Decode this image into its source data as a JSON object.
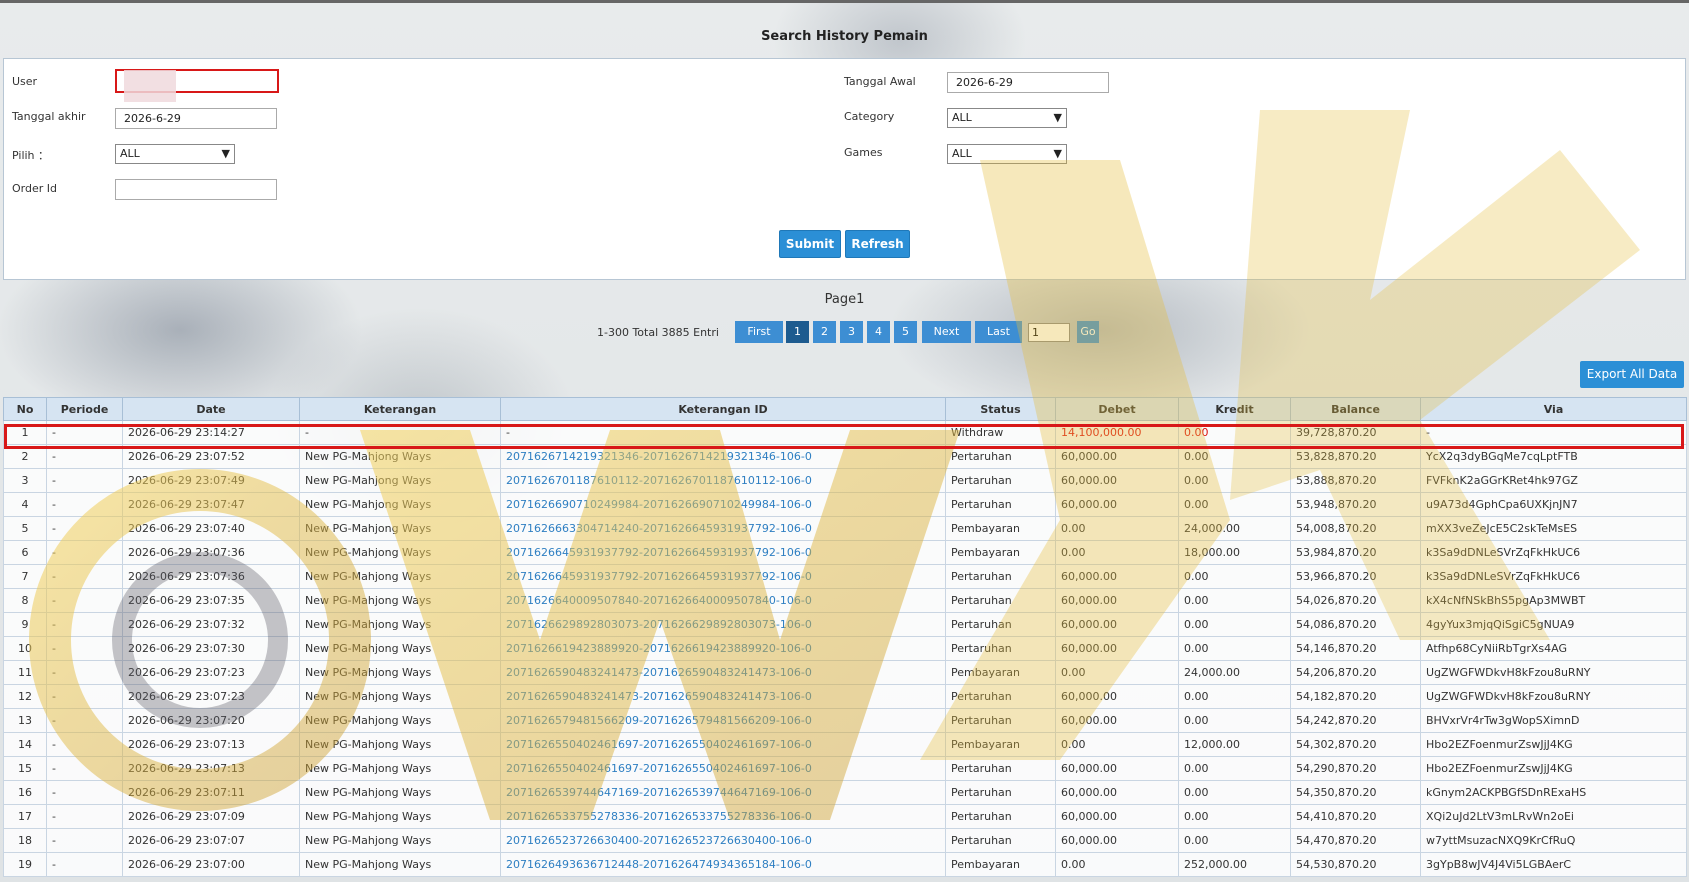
{
  "page": {
    "title": "Search History Pemain",
    "page_label": "Page1"
  },
  "form": {
    "user_label": "User",
    "user_value": "",
    "tanggal_akhir_label": "Tanggal akhir",
    "tanggal_akhir_value": "2026-6-29",
    "pilih_label": "Pilih ：",
    "pilih_value": "ALL",
    "order_id_label": "Order Id",
    "order_id_value": "",
    "tanggal_awal_label": "Tanggal Awal",
    "tanggal_awal_value": "2026-6-29",
    "category_label": "Category",
    "category_value": "ALL",
    "games_label": "Games",
    "games_value": "ALL",
    "submit_label": "Submit",
    "refresh_label": "Refresh"
  },
  "pager": {
    "info": "1-300 Total 3885 Entri",
    "first": "First",
    "pages": [
      "1",
      "2",
      "3",
      "4",
      "5"
    ],
    "active_page": "1",
    "next": "Next",
    "last": "Last",
    "goto_value": "1",
    "go": "Go"
  },
  "export_label": "Export All Data",
  "table": {
    "headers": [
      "No",
      "Periode",
      "Date",
      "Keterangan",
      "Keterangan ID",
      "Status",
      "Debet",
      "Kredit",
      "Balance",
      "Via"
    ],
    "rows": [
      [
        "1",
        "-",
        "2026-06-29 23:14:27",
        "-",
        "-",
        "Withdraw",
        "14,100,000.00",
        "0.00",
        "39,728,870.20",
        "-"
      ],
      [
        "2",
        "-",
        "2026-06-29 23:07:52",
        "New PG-Mahjong Ways",
        "2071626714219321346-2071626714219321346-106-0",
        "Pertaruhan",
        "60,000.00",
        "0.00",
        "53,828,870.20",
        "YcX2q3dyBGqMe7cqLptFTB"
      ],
      [
        "3",
        "-",
        "2026-06-29 23:07:49",
        "New PG-Mahjong Ways",
        "2071626701187610112-2071626701187610112-106-0",
        "Pertaruhan",
        "60,000.00",
        "0.00",
        "53,888,870.20",
        "FVFknK2aGGrKRet4hk97GZ"
      ],
      [
        "4",
        "-",
        "2026-06-29 23:07:47",
        "New PG-Mahjong Ways",
        "2071626690710249984-2071626690710249984-106-0",
        "Pertaruhan",
        "60,000.00",
        "0.00",
        "53,948,870.20",
        "u9A73d4GphCpa6UXKjnJN7"
      ],
      [
        "5",
        "-",
        "2026-06-29 23:07:40",
        "New PG-Mahjong Ways",
        "2071626663304714240-2071626645931937792-106-0",
        "Pembayaran",
        "0.00",
        "24,000.00",
        "54,008,870.20",
        "mXX3veZeJcE5C2skTeMsES"
      ],
      [
        "6",
        "-",
        "2026-06-29 23:07:36",
        "New PG-Mahjong Ways",
        "2071626645931937792-2071626645931937792-106-0",
        "Pembayaran",
        "0.00",
        "18,000.00",
        "53,984,870.20",
        "k3Sa9dDNLeSVrZqFkHkUC6"
      ],
      [
        "7",
        "-",
        "2026-06-29 23:07:36",
        "New PG-Mahjong Ways",
        "2071626645931937792-2071626645931937792-106-0",
        "Pertaruhan",
        "60,000.00",
        "0.00",
        "53,966,870.20",
        "k3Sa9dDNLeSVrZqFkHkUC6"
      ],
      [
        "8",
        "-",
        "2026-06-29 23:07:35",
        "New PG-Mahjong Ways",
        "2071626640009507840-2071626640009507840-106-0",
        "Pertaruhan",
        "60,000.00",
        "0.00",
        "54,026,870.20",
        "kX4cNfNSkBhS5pgAp3MWBT"
      ],
      [
        "9",
        "-",
        "2026-06-29 23:07:32",
        "New PG-Mahjong Ways",
        "2071626629892803073-2071626629892803073-106-0",
        "Pertaruhan",
        "60,000.00",
        "0.00",
        "54,086,870.20",
        "4gyYux3mjqQiSgiC5gNUA9"
      ],
      [
        "10",
        "-",
        "2026-06-29 23:07:30",
        "New PG-Mahjong Ways",
        "2071626619423889920-2071626619423889920-106-0",
        "Pertaruhan",
        "60,000.00",
        "0.00",
        "54,146,870.20",
        "Atfhp68CyNiiRbTgrXs4AG"
      ],
      [
        "11",
        "-",
        "2026-06-29 23:07:23",
        "New PG-Mahjong Ways",
        "2071626590483241473-2071626590483241473-106-0",
        "Pembayaran",
        "0.00",
        "24,000.00",
        "54,206,870.20",
        "UgZWGFWDkvH8kFzou8uRNY"
      ],
      [
        "12",
        "-",
        "2026-06-29 23:07:23",
        "New PG-Mahjong Ways",
        "2071626590483241473-2071626590483241473-106-0",
        "Pertaruhan",
        "60,000.00",
        "0.00",
        "54,182,870.20",
        "UgZWGFWDkvH8kFzou8uRNY"
      ],
      [
        "13",
        "-",
        "2026-06-29 23:07:20",
        "New PG-Mahjong Ways",
        "2071626579481566209-2071626579481566209-106-0",
        "Pertaruhan",
        "60,000.00",
        "0.00",
        "54,242,870.20",
        "BHVxrVr4rTw3gWopSXimnD"
      ],
      [
        "14",
        "-",
        "2026-06-29 23:07:13",
        "New PG-Mahjong Ways",
        "2071626550402461697-2071626550402461697-106-0",
        "Pembayaran",
        "0.00",
        "12,000.00",
        "54,302,870.20",
        "Hbo2EZFoenmurZswJjJ4KG"
      ],
      [
        "15",
        "-",
        "2026-06-29 23:07:13",
        "New PG-Mahjong Ways",
        "2071626550402461697-2071626550402461697-106-0",
        "Pertaruhan",
        "60,000.00",
        "0.00",
        "54,290,870.20",
        "Hbo2EZFoenmurZswJjJ4KG"
      ],
      [
        "16",
        "-",
        "2026-06-29 23:07:11",
        "New PG-Mahjong Ways",
        "2071626539744647169-2071626539744647169-106-0",
        "Pertaruhan",
        "60,000.00",
        "0.00",
        "54,350,870.20",
        "kGnym2ACKPBGfSDnRExaHS"
      ],
      [
        "17",
        "-",
        "2026-06-29 23:07:09",
        "New PG-Mahjong Ways",
        "2071626533755278336-2071626533755278336-106-0",
        "Pertaruhan",
        "60,000.00",
        "0.00",
        "54,410,870.20",
        "XQi2uJd2LtV3mLRvWn2oEi"
      ],
      [
        "18",
        "-",
        "2026-06-29 23:07:07",
        "New PG-Mahjong Ways",
        "2071626523726630400-2071626523726630400-106-0",
        "Pertaruhan",
        "60,000.00",
        "0.00",
        "54,470,870.20",
        "w7yttMsuzacNXQ9KrCfRuQ"
      ],
      [
        "19",
        "-",
        "2026-06-29 23:07:00",
        "New PG-Mahjong Ways",
        "2071626493636712448-2071626474934365184-106-0",
        "Pembayaran",
        "0.00",
        "252,000.00",
        "54,530,870.20",
        "3gYpB8wJV4J4Vi5LGBAerC"
      ]
    ]
  },
  "colors": {
    "accent": "#2b8fd6",
    "highlight": "#d81818",
    "link": "#2e7fc2"
  }
}
